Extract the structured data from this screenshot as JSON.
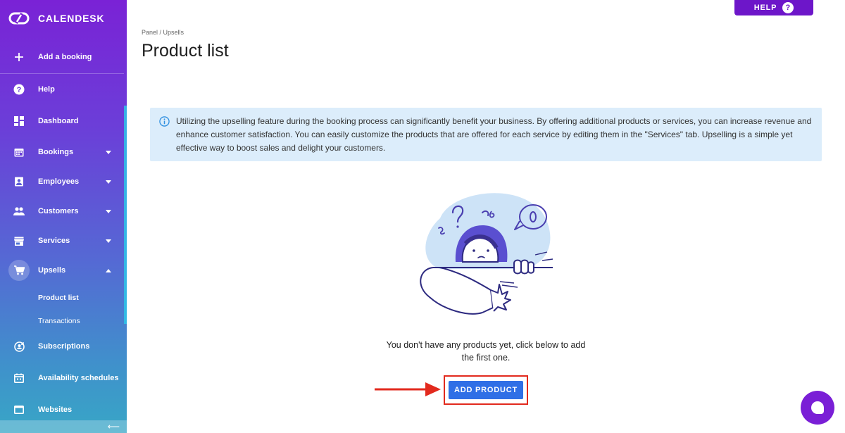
{
  "app": {
    "brand_name": "CALENDESK",
    "brand_color": "#7a22d6"
  },
  "header": {
    "help_label": "HELP",
    "help_icon": "question-icon"
  },
  "sidebar": {
    "items": [
      {
        "label": "Add a booking",
        "icon": "plus-icon"
      },
      {
        "label": "Help",
        "icon": "question-circle-icon"
      },
      {
        "label": "Dashboard",
        "icon": "dashboard-icon"
      },
      {
        "label": "Bookings",
        "icon": "calendar-icon",
        "expandable": true
      },
      {
        "label": "Employees",
        "icon": "id-badge-icon",
        "expandable": true
      },
      {
        "label": "Customers",
        "icon": "people-icon",
        "expandable": true
      },
      {
        "label": "Services",
        "icon": "store-icon",
        "expandable": true
      },
      {
        "label": "Upsells",
        "icon": "cart-icon",
        "expanded": true
      },
      {
        "label": "Subscriptions",
        "icon": "subscription-icon"
      },
      {
        "label": "Availability schedules",
        "icon": "schedule-calendar-icon"
      },
      {
        "label": "Websites",
        "icon": "browser-window-icon"
      }
    ],
    "upsells_sub": [
      {
        "label": "Product list",
        "active": true
      },
      {
        "label": "Transactions",
        "active": false
      }
    ],
    "collapse_icon": "arrow-left-icon"
  },
  "main": {
    "breadcrumb": "Panel / Upsells",
    "title": "Product list",
    "info_text": "Utilizing the upselling feature during the booking process can significantly benefit your business. By offering additional products or services, you can increase revenue and enhance customer satisfaction. You can easily customize the products that are offered for each service by editing them in the \"Services\" tab. Upselling is a simple yet effective way to boost sales and delight your customers.",
    "empty_text": "You don't have any products yet, click below to add the first one.",
    "add_button_label": "ADD PRODUCT",
    "add_button_color": "#2f6fe6",
    "highlight_color": "#e22a1e"
  },
  "chat": {
    "icon": "chat-bubble-icon"
  }
}
